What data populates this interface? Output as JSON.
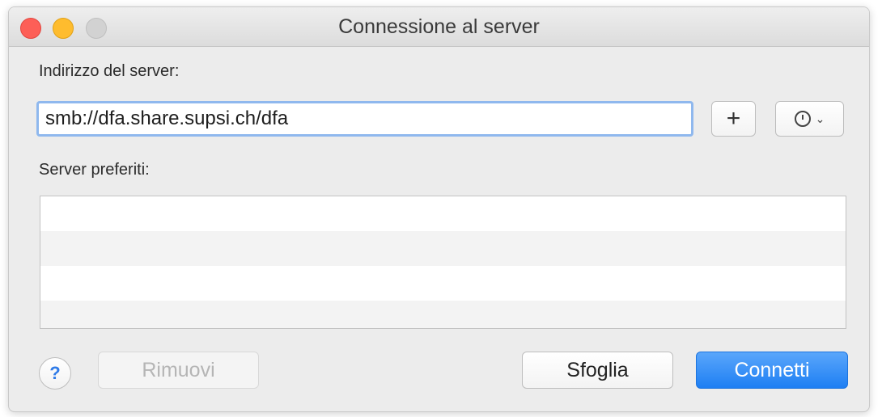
{
  "window": {
    "title": "Connessione al server"
  },
  "form": {
    "address_label": "Indirizzo del server:",
    "address_value": "smb://dfa.share.supsi.ch/dfa",
    "add_button_label": "+",
    "history_icon": "clock-icon",
    "favorites_label": "Server preferiti:",
    "favorites": []
  },
  "buttons": {
    "help_label": "?",
    "remove_label": "Rimuovi",
    "browse_label": "Sfoglia",
    "connect_label": "Connetti"
  },
  "colors": {
    "accent": "#1e7ff3",
    "focus_ring": "#8fb8ee",
    "close": "#fd5f57",
    "minimize": "#febc2e"
  }
}
